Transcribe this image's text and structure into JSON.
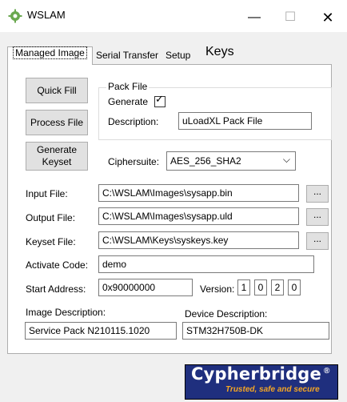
{
  "window": {
    "title": "WSLAM",
    "minimize_glyph": "—",
    "maximize_glyph": "☐",
    "close_glyph": "✕"
  },
  "tabs": [
    {
      "label": "Managed Image"
    },
    {
      "label": "Serial Transfer"
    },
    {
      "label": "Setup"
    },
    {
      "label": "Keys"
    }
  ],
  "buttons": {
    "quick_fill": "Quick Fill",
    "process_file": "Process File",
    "generate_keyset_line1": "Generate",
    "generate_keyset_line2": "Keyset"
  },
  "pack_file": {
    "legend": "Pack File",
    "generate_label": "Generate",
    "generate_checked": true,
    "description_label": "Description:",
    "description_value": "uLoadXL Pack File"
  },
  "ciphersuite": {
    "label": "Ciphersuite:",
    "value": "AES_256_SHA2"
  },
  "files": {
    "input_label": "Input File:",
    "input_value": "C:\\WSLAM\\Images\\sysapp.bin",
    "output_label": "Output File:",
    "output_value": "C:\\WSLAM\\Images\\sysapp.uld",
    "keyset_label": "Keyset File:",
    "keyset_value": "C:\\WSLAM\\Keys\\syskeys.key",
    "browse_label": "..."
  },
  "activate": {
    "label": "Activate Code:",
    "value": "demo"
  },
  "start_address": {
    "label": "Start Address:",
    "value": "0x90000000"
  },
  "version": {
    "label": "Version:",
    "parts": [
      "1",
      "0",
      "2",
      "0"
    ]
  },
  "image_description": {
    "label": "Image Description:",
    "value": "Service Pack N210115.1020"
  },
  "device_description": {
    "label": "Device Description:",
    "value": "STM32H750B-DK"
  },
  "logo": {
    "name": "Cypherbridge",
    "tagline": "Trusted, safe and secure",
    "color": "#1f2f7e",
    "accent": "#f5a623"
  },
  "icons": {
    "app": "gear-icon",
    "checkmark": "checkmark-icon",
    "dropdown": "chevron-down-icon"
  }
}
